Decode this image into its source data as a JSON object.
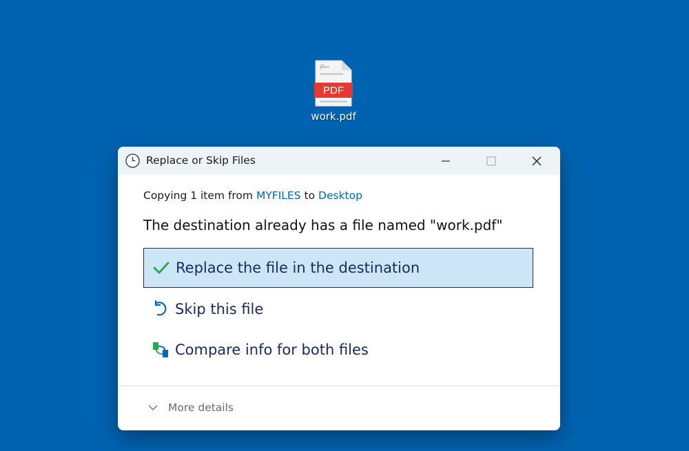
{
  "desktop": {
    "background": "#0063b1",
    "file_icon": {
      "label": "work.pdf",
      "badge": "PDF",
      "glyph": "P",
      "icon": "pdf-file-icon",
      "badge_color": "#e53935"
    }
  },
  "dialog": {
    "title": "Replace or Skip Files",
    "title_icon": "clock-icon",
    "controls": {
      "minimize_icon": "minimize-icon",
      "maximize_icon": "maximize-icon",
      "close_icon": "close-icon"
    },
    "copy_prefix": "Copying 1 item from",
    "source": "MYFILES",
    "copy_to": "to",
    "destination": "Desktop",
    "message": "The destination already has a file named \"work.pdf\"",
    "options": [
      {
        "label": "Replace the file in the destination",
        "icon": "checkmark-icon",
        "selected": true
      },
      {
        "label": "Skip this file",
        "icon": "undo-arrow-icon",
        "selected": false
      },
      {
        "label": "Compare info for both files",
        "icon": "compare-icon",
        "selected": false
      }
    ],
    "more_details": "More details",
    "link_color": "#0067c0",
    "selected_bg": "#cde6f7"
  }
}
